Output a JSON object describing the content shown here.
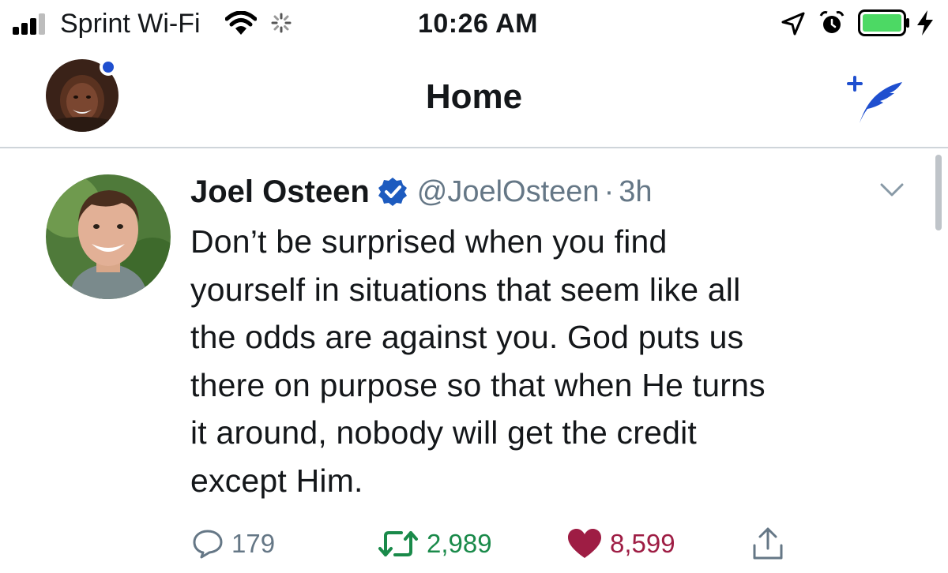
{
  "status_bar": {
    "carrier": "Sprint Wi-Fi",
    "time": "10:26 AM",
    "battery_color": "#4cd964"
  },
  "nav": {
    "title": "Home",
    "notification_dot_color": "#1f4fcf",
    "compose_icon": "compose-tweet-icon"
  },
  "tweet": {
    "author_name": "Joel Osteen",
    "verified": true,
    "handle": "@JoelOsteen",
    "separator": "·",
    "time": "3h",
    "text": "Don’t be surprised when you find\nyourself in situations that seem like all\nthe odds are against you. God puts us\nthere on purpose so that when He turns\nit around, nobody will get the credit\nexcept Him.",
    "actions": {
      "replies": "179",
      "retweets": "2,989",
      "likes": "8,599"
    },
    "colors": {
      "retweet": "#1a8a4a",
      "like": "#9e1d44",
      "verified": "#1d5bbf",
      "accent": "#1f4fcf"
    }
  }
}
